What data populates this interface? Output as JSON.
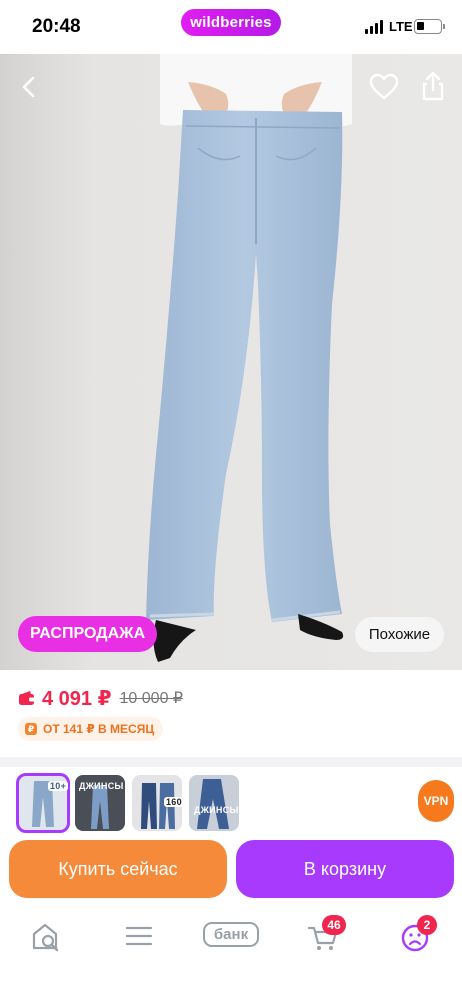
{
  "status_bar": {
    "time": "20:48",
    "network": "LTE",
    "brand": "wildberries"
  },
  "product": {
    "sale_badge": "РАСПРОДАЖА",
    "similar_label": "Похожие",
    "price_current": "4 091 ₽",
    "price_old": "10 000 ₽",
    "installment": "ОТ 141 ₽ В МЕСЯЦ",
    "installment_icon": "₽"
  },
  "thumbnails": [
    {
      "label": "10+",
      "selected": true
    },
    {
      "label": "ДЖИНСЫ",
      "selected": false
    },
    {
      "label": "160+",
      "selected": false
    },
    {
      "label": "ДЖИНСЫ",
      "selected": false
    }
  ],
  "vpn_label": "VPN",
  "actions": {
    "buy_now": "Купить сейчас",
    "add_to_cart": "В корзину"
  },
  "tab_bar": {
    "bank_label": "банк",
    "cart_count": "46",
    "profile_count": "2"
  },
  "colors": {
    "brand": "#b51ae8",
    "price": "#f0264f",
    "buy_now": "#f58a3a",
    "add_to_cart": "#a73afd",
    "sale_badge": "#e82fe3"
  },
  "icons": [
    "chevron-left-icon",
    "heart-icon",
    "share-icon",
    "wallet-icon",
    "search-home-icon",
    "menu-icon",
    "cart-icon",
    "profile-icon"
  ]
}
